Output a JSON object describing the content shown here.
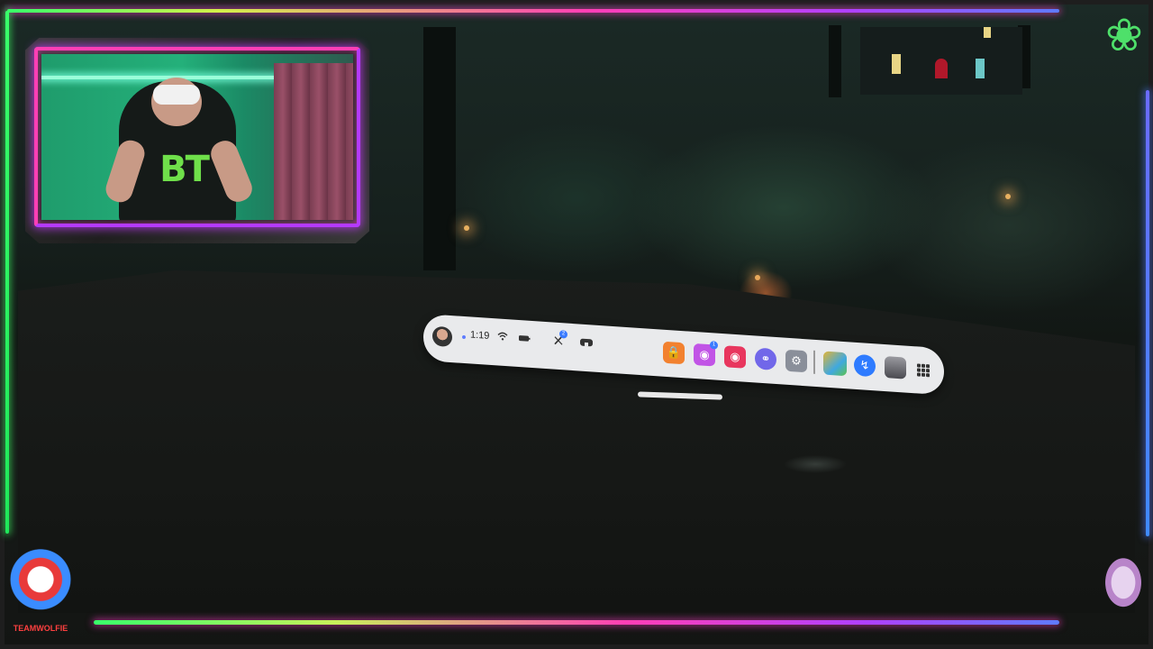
{
  "stream_overlay": {
    "webcam": {
      "shirt_text": "BT"
    },
    "wolf_logo_text": "TEAMWOLFIE"
  },
  "vr_menu": {
    "time": "1:19",
    "status_icons": [
      "profile-avatar-icon",
      "wifi-icon",
      "battery-icon",
      "quick-action-icon",
      "headset-icon"
    ],
    "quick_action_badge": "2",
    "apps": [
      {
        "name": "store-app",
        "color": "#f2812f"
      },
      {
        "name": "people-app",
        "color": "#c154e6",
        "badge": "1"
      },
      {
        "name": "camera-app",
        "color": "#e8365e"
      },
      {
        "name": "browser-app",
        "color": "#7167e9"
      },
      {
        "name": "settings-app",
        "color": "#8a8f9a"
      },
      {
        "name": "game-app",
        "color": "#e5b534"
      },
      {
        "name": "messenger-app",
        "color": "#2e7bff"
      },
      {
        "name": "horizon-app",
        "color": "#6a6a70"
      }
    ]
  },
  "colors": {
    "neon_green": "#39ff6a",
    "neon_pink": "#ff3fb5",
    "neon_purple": "#b040ff",
    "neon_blue": "#5f7bff"
  }
}
